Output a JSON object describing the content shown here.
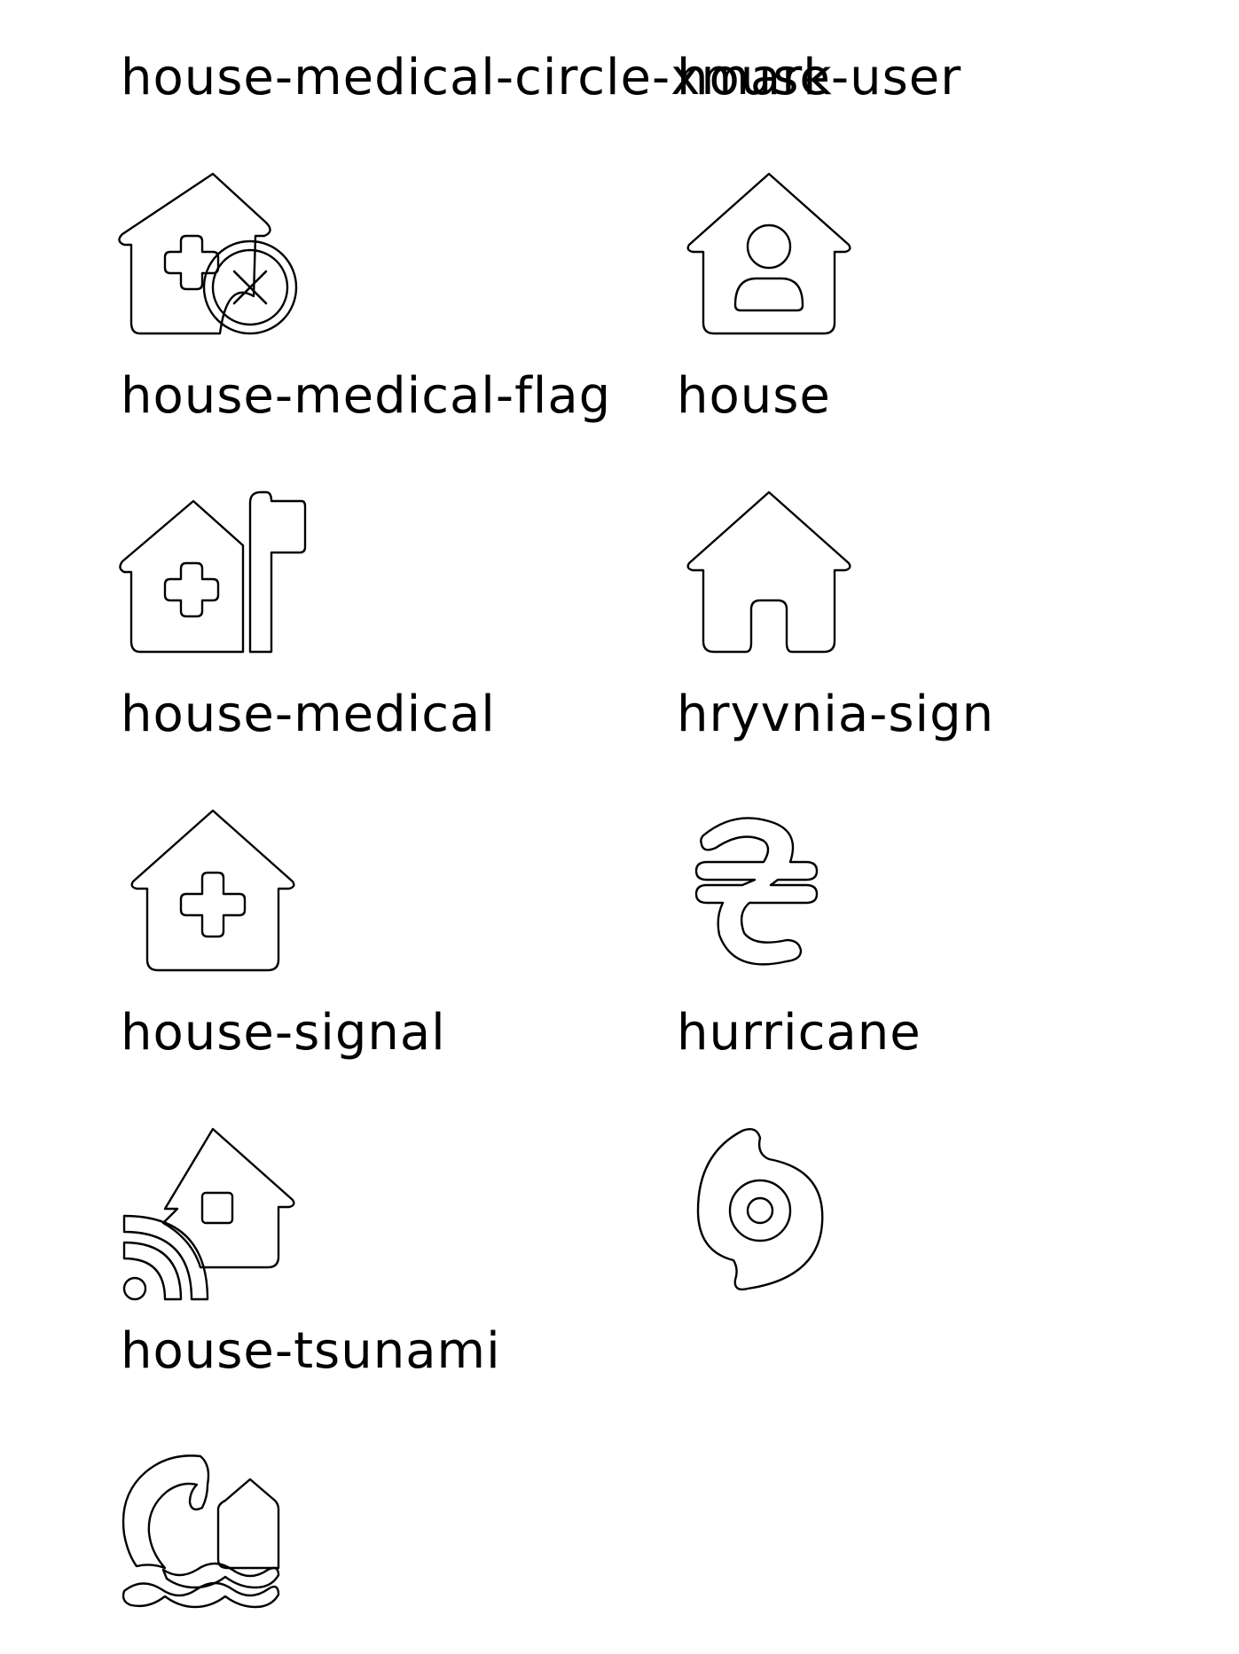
{
  "icons": [
    {
      "name": "house-medical-circle-xmark",
      "icon": "house-medical-circle-xmark-icon"
    },
    {
      "name": "house-user",
      "icon": "house-user-icon"
    },
    {
      "name": "house-medical-flag",
      "icon": "house-medical-flag-icon"
    },
    {
      "name": "house",
      "icon": "house-icon"
    },
    {
      "name": "house-medical",
      "icon": "house-medical-icon"
    },
    {
      "name": "hryvnia-sign",
      "icon": "hryvnia-sign-icon"
    },
    {
      "name": "house-signal",
      "icon": "house-signal-icon"
    },
    {
      "name": "hurricane",
      "icon": "hurricane-icon"
    },
    {
      "name": "house-tsunami",
      "icon": "house-tsunami-icon"
    }
  ]
}
